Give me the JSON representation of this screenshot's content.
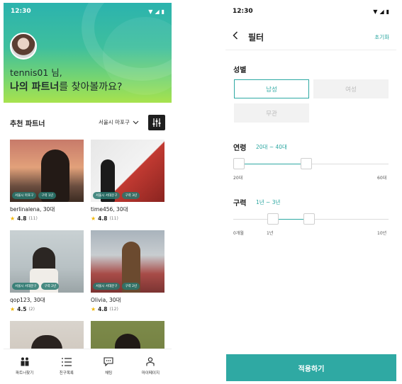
{
  "left": {
    "status": {
      "time": "12:30"
    },
    "greeting": {
      "line1": "tennis01 님,",
      "line2_bold": "나의 파트너",
      "line2_rest": "를 찾아볼까요?"
    },
    "section_title": "추천 파트너",
    "location": "서울시 마포구",
    "cards": [
      {
        "name": "berlinalena,",
        "age": "30대",
        "rating": "4.8",
        "count": "(11)",
        "tags": [
          "서울시 마포구",
          "구력 1년"
        ]
      },
      {
        "name": "time456,",
        "age": "30대",
        "rating": "4.8",
        "count": "(11)",
        "tags": [
          "서울시 서대문구",
          "구력 3년"
        ]
      },
      {
        "name": "qop123,",
        "age": "30대",
        "rating": "4.5",
        "count": "(2)",
        "tags": [
          "서울시 서대문구",
          "구력 2년"
        ]
      },
      {
        "name": "Olivia,",
        "age": "30대",
        "rating": "4.8",
        "count": "(12)",
        "tags": [
          "서울시 서대문구",
          "구력 2년"
        ]
      }
    ],
    "tabs": [
      "파트너찾기",
      "친구목록",
      "채팅",
      "마이페이지"
    ]
  },
  "right": {
    "status": {
      "time": "12:30"
    },
    "title": "필터",
    "reset": "초기화",
    "gender": {
      "label": "성별",
      "options": [
        "남성",
        "여성",
        "무관"
      ],
      "selected": "남성"
    },
    "age": {
      "label": "연령",
      "value": "20대 ~ 40대",
      "min_label": "20대",
      "max_label": "60대"
    },
    "career": {
      "label": "구력",
      "value": "1년 ~ 3년",
      "min_label": "0개월",
      "mid_label": "1년",
      "max_label": "10년"
    },
    "apply": "적용하기"
  }
}
